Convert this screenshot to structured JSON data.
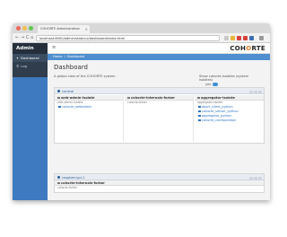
{
  "browser": {
    "tab_title": "COHORTE Administration",
    "url": "localhost:8000/admin/static/ui/dashboard/index.html",
    "tab_close": "×",
    "back_glyph": "←",
    "forward_glyph": "→",
    "reload_glyph": "C",
    "home_glyph": "⌂"
  },
  "sidebar": {
    "brand": "Admin",
    "items": [
      {
        "icon": "dashboard-icon",
        "glyph": "✦",
        "label": "Dashboard",
        "active": true
      },
      {
        "icon": "log-icon",
        "glyph": "☰",
        "label": "Log",
        "active": false
      }
    ]
  },
  "topbar": {
    "menu_glyph": "≡",
    "logo_left": "COH",
    "logo_o": "O",
    "logo_right": "RTE"
  },
  "breadcrumb": [
    "Home",
    "Dashboard"
  ],
  "breadcrumb_sep": "/",
  "page": {
    "title": "Dashboard",
    "subtitle": "A global view of the COHORTE system",
    "show_system_label": "Show cohorte-isolates (system isolates)",
    "toggle_label": "yes"
  },
  "node_panels": [
    {
      "name": "central",
      "isolates": [
        {
          "name": "web-admin-isolate",
          "sub": "web-admin-isolate",
          "components": [
            "cohorte_webadmin"
          ]
        },
        {
          "name": "cohorte-internals-forker",
          "sub": "cohorte-forker",
          "components": []
        },
        {
          "name": "aggregator-isolate",
          "sub": "aggregator-isolate",
          "components": [
            "abort_client_python",
            "cohorte_sensor_python",
            "aggregator_python",
            "cohorte_configuration"
          ]
        }
      ]
    },
    {
      "name": "raspberrypi-1",
      "isolates": [
        {
          "name": "cohorte-internals-forker",
          "sub": "cohorte-forker",
          "components": []
        }
      ]
    }
  ],
  "colors": {
    "sidebar_dark": "#2f3d4c",
    "sidebar_blue": "#3d7abf",
    "accent_blue": "#4f8fcf",
    "logo_orange": "#e37b2b",
    "link_blue": "#2f73c5"
  }
}
